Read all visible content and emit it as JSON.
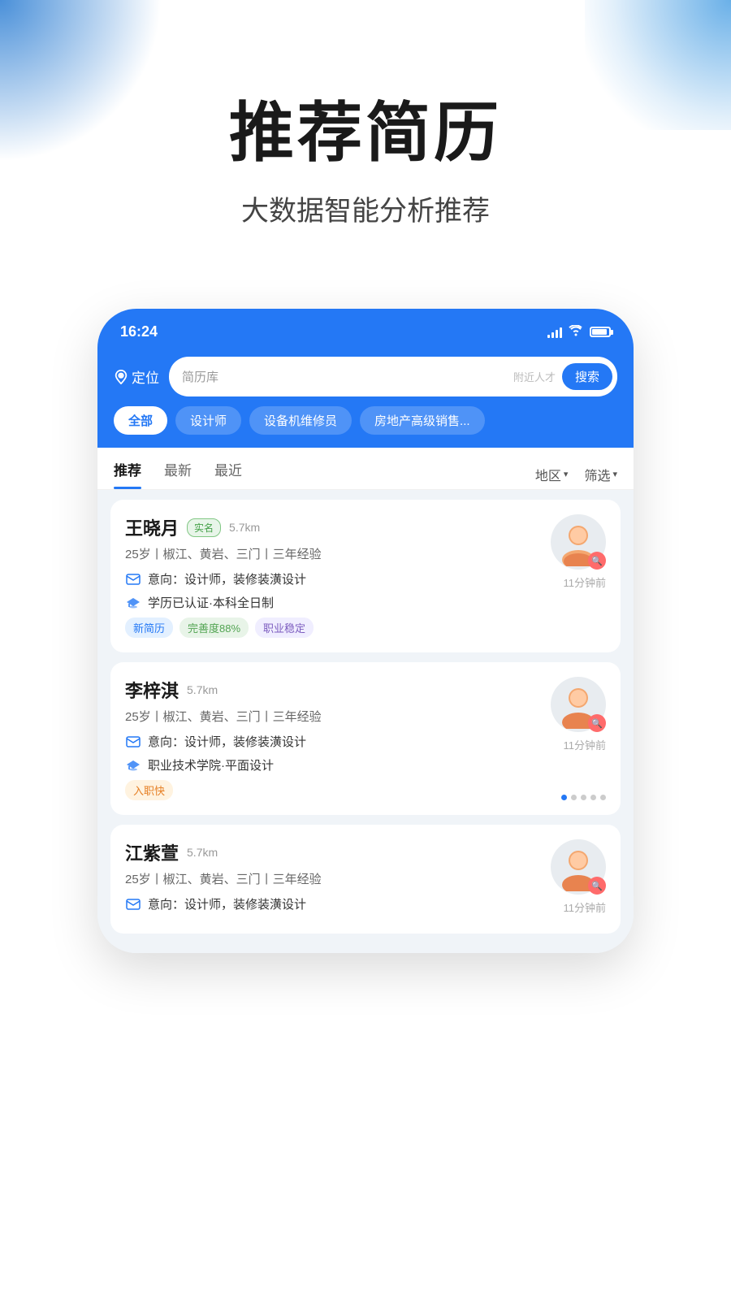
{
  "background": {
    "color": "#ffffff"
  },
  "hero": {
    "title": "推荐简历",
    "subtitle": "大数据智能分析推荐"
  },
  "statusBar": {
    "time": "16:24",
    "signal": "signal",
    "wifi": "wifi",
    "battery": "battery"
  },
  "header": {
    "location_label": "定位",
    "search_placeholder": "简历库",
    "search_sub": "附近人才",
    "search_btn": "搜索"
  },
  "filterTags": [
    {
      "label": "全部",
      "active": true
    },
    {
      "label": "设计师",
      "active": false
    },
    {
      "label": "设备机维修员",
      "active": false
    },
    {
      "label": "房地产高级销售...",
      "active": false
    }
  ],
  "tabs": {
    "items": [
      {
        "label": "推荐",
        "active": true
      },
      {
        "label": "最新",
        "active": false
      },
      {
        "label": "最近",
        "active": false
      }
    ],
    "filter_region": "地区",
    "filter_screen": "筛选"
  },
  "candidates": [
    {
      "name": "王晓月",
      "verified": "实名",
      "distance": "5.7km",
      "info": "25岁丨椒江、黄岩、三门丨三年经验",
      "intention": "意向：设计师，装修装潢设计",
      "education": "学历已认证·本科全日制",
      "time": "11分钟前",
      "tags": [
        {
          "label": "新简历",
          "type": "new"
        },
        {
          "label": "完善度88%",
          "type": "complete"
        },
        {
          "label": "职业稳定",
          "type": "stable"
        }
      ],
      "has_verified": true,
      "has_pagination": false
    },
    {
      "name": "李梓淇",
      "verified": "",
      "distance": "5.7km",
      "info": "25岁丨椒江、黄岩、三门丨三年经验",
      "intention": "意向：设计师，装修装潢设计",
      "education": "职业技术学院·平面设计",
      "time": "11分钟前",
      "tags": [
        {
          "label": "入职快",
          "type": "fast"
        }
      ],
      "has_verified": false,
      "has_pagination": true
    },
    {
      "name": "江紫萱",
      "verified": "",
      "distance": "5.7km",
      "info": "25岁丨椒江、黄岩、三门丨三年经验",
      "intention": "意向：设计师，装修装潢设计",
      "education": "",
      "time": "11分钟前",
      "tags": [],
      "has_verified": false,
      "has_pagination": false
    }
  ],
  "icons": {
    "location": "📍",
    "search": "🔍",
    "envelope": "✉",
    "graduation": "🎓",
    "avatar_search": "🔍"
  }
}
